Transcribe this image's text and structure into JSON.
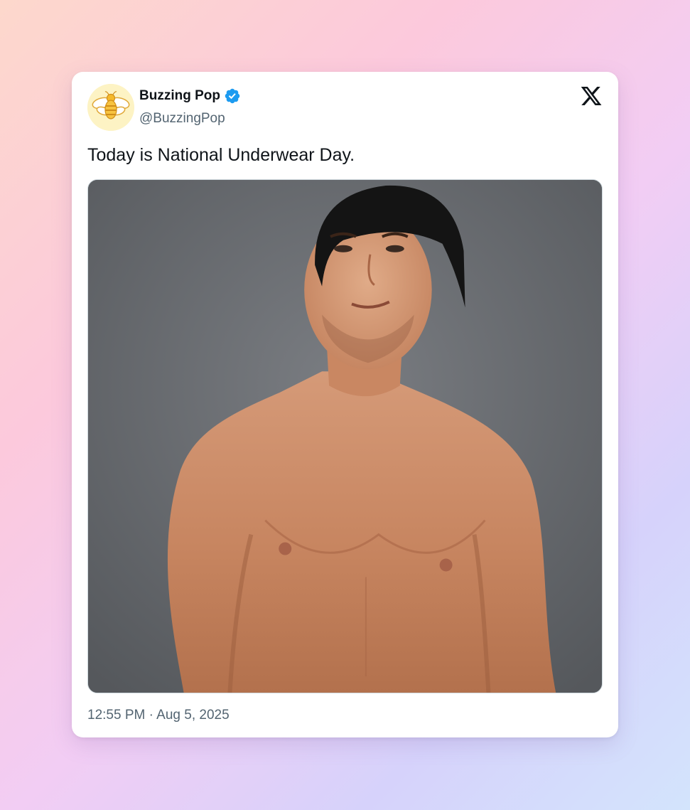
{
  "post": {
    "author_name": "Buzzing Pop",
    "author_handle": "@BuzzingPop",
    "verified": true,
    "text": "Today is National Underwear Day.",
    "timestamp": "12:55 PM · Aug 5, 2025"
  },
  "icons": {
    "avatar": "bee-icon",
    "verified": "verified-badge-icon",
    "brand": "x-logo-icon"
  },
  "colors": {
    "card_background": "#ffffff",
    "text_primary": "#0f1419",
    "text_secondary": "#536471",
    "verified_blue": "#1d9bf0",
    "photo_backdrop": "#6b6e72"
  }
}
